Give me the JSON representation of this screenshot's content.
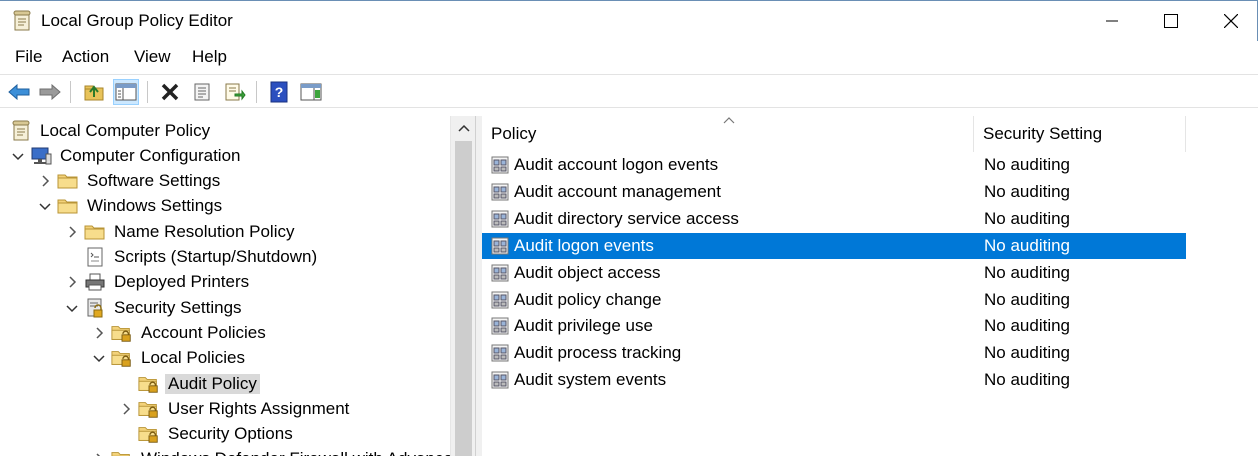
{
  "window": {
    "title": "Local Group Policy Editor",
    "icon": "policy-document-icon"
  },
  "menu": [
    "File",
    "Action",
    "View",
    "Help"
  ],
  "toolbar": {
    "buttons": [
      "back-arrow-icon",
      "forward-arrow-icon",
      "up-folder-icon",
      "show-hide-tree-icon",
      "delete-icon",
      "properties-icon",
      "export-list-icon",
      "help-icon",
      "show-action-pane-icon"
    ]
  },
  "tree": {
    "items": [
      {
        "label": "Local Computer Policy",
        "icon": "policy-document-icon",
        "expander": "none"
      },
      {
        "label": "Computer Configuration",
        "icon": "computer-icon",
        "expander": "expanded"
      },
      {
        "label": "Software Settings",
        "icon": "folder-icon",
        "expander": "collapsed"
      },
      {
        "label": "Windows Settings",
        "icon": "folder-icon",
        "expander": "expanded"
      },
      {
        "label": "Name Resolution Policy",
        "icon": "folder-icon",
        "expander": "collapsed"
      },
      {
        "label": "Scripts (Startup/Shutdown)",
        "icon": "script-icon",
        "expander": "none"
      },
      {
        "label": "Deployed Printers",
        "icon": "printer-icon",
        "expander": "collapsed"
      },
      {
        "label": "Security Settings",
        "icon": "security-icon",
        "expander": "expanded"
      },
      {
        "label": "Account Policies",
        "icon": "locked-folder-icon",
        "expander": "collapsed"
      },
      {
        "label": "Local Policies",
        "icon": "locked-folder-icon",
        "expander": "expanded"
      },
      {
        "label": "Audit Policy",
        "icon": "locked-folder-icon",
        "expander": "none",
        "selected": true
      },
      {
        "label": "User Rights Assignment",
        "icon": "locked-folder-icon",
        "expander": "collapsed"
      },
      {
        "label": "Security Options",
        "icon": "locked-folder-icon",
        "expander": "none"
      },
      {
        "label": "Windows Defender Firewall with Advanced Security",
        "icon": "locked-folder-icon",
        "expander": "collapsed"
      }
    ]
  },
  "list": {
    "columns": [
      "Policy",
      "Security Setting"
    ],
    "rows": [
      {
        "policy": "Audit account logon events",
        "setting": "No auditing"
      },
      {
        "policy": "Audit account management",
        "setting": "No auditing"
      },
      {
        "policy": "Audit directory service access",
        "setting": "No auditing"
      },
      {
        "policy": "Audit logon events",
        "setting": "No auditing",
        "selected": true
      },
      {
        "policy": "Audit object access",
        "setting": "No auditing"
      },
      {
        "policy": "Audit policy change",
        "setting": "No auditing"
      },
      {
        "policy": "Audit privilege use",
        "setting": "No auditing"
      },
      {
        "policy": "Audit process tracking",
        "setting": "No auditing"
      },
      {
        "policy": "Audit system events",
        "setting": "No auditing"
      }
    ]
  },
  "colors": {
    "selection": "#0078d7",
    "tree_selection": "#d9d9d9",
    "toolbar_active": "#cce8ff"
  }
}
